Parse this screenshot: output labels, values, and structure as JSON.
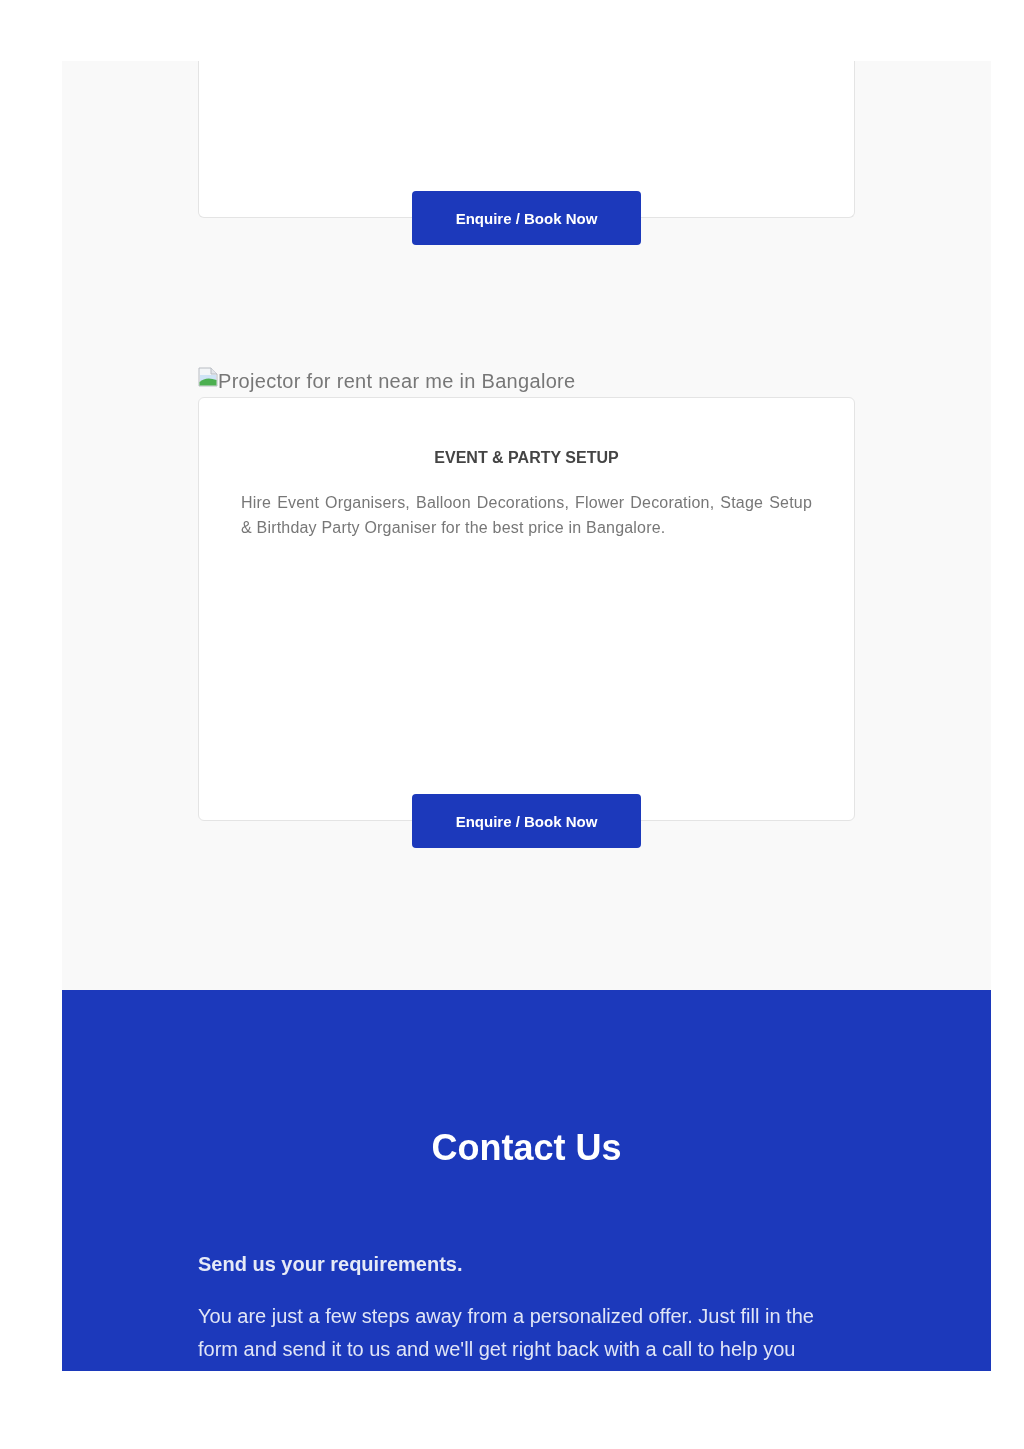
{
  "service_cards": [
    {
      "button": "Enquire / Book Now"
    },
    {
      "image_alt": "Projector for rent near me in Bangalore",
      "title": "EVENT & PARTY SETUP",
      "description": "Hire Event Organisers, Balloon Decorations, Flower Decoration, Stage Setup & Birthday Party Organiser for the best price in Bangalore.",
      "button": "Enquire / Book Now"
    }
  ],
  "contact": {
    "heading": "Contact Us",
    "subheading": "Send us your requirements.",
    "text": "You are just a few steps away from a personalized offer. Just fill in the form and send it to us and we'll get right back with a call to help you"
  }
}
